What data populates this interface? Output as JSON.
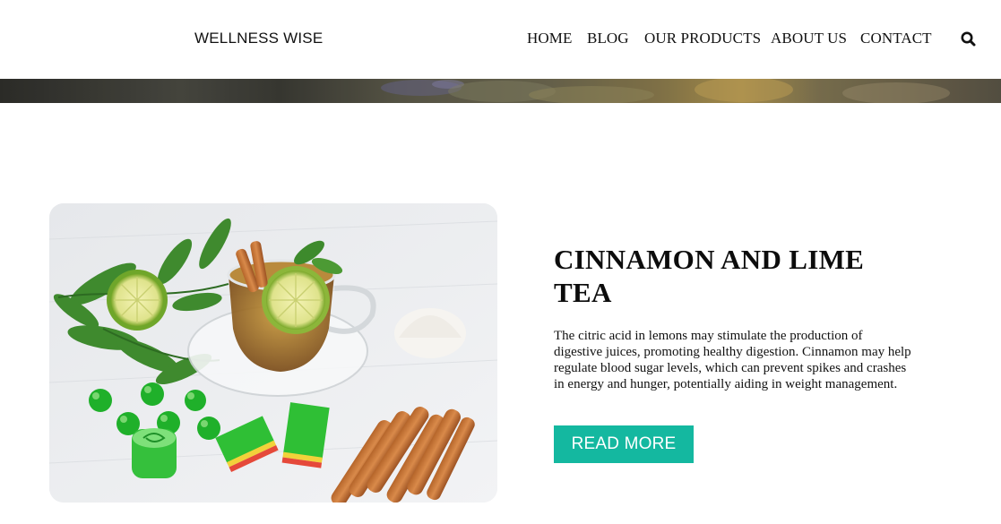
{
  "header": {
    "brand": "WELLNESS WISE",
    "nav": [
      {
        "label": "HOME"
      },
      {
        "label": "BLOG"
      },
      {
        "label": "OUR PRODUCTS"
      },
      {
        "label": "ABOUT US"
      },
      {
        "label": "CONTACT"
      }
    ],
    "search_icon": "search-icon"
  },
  "post": {
    "image_subject": "cup of cinnamon and lime tea with green jelly candies",
    "title": "CINNAMON AND LIME TEA",
    "excerpt": "The citric acid in lemons may stimulate the production of digestive juices, promoting healthy digestion. Cinnamon may help regulate blood sugar levels, which can prevent spikes and crashes in energy and hunger, potentially aiding in weight management.",
    "button_label": "READ MORE"
  },
  "colors": {
    "accent": "#14b8a0",
    "text": "#111111",
    "background": "#ffffff"
  }
}
